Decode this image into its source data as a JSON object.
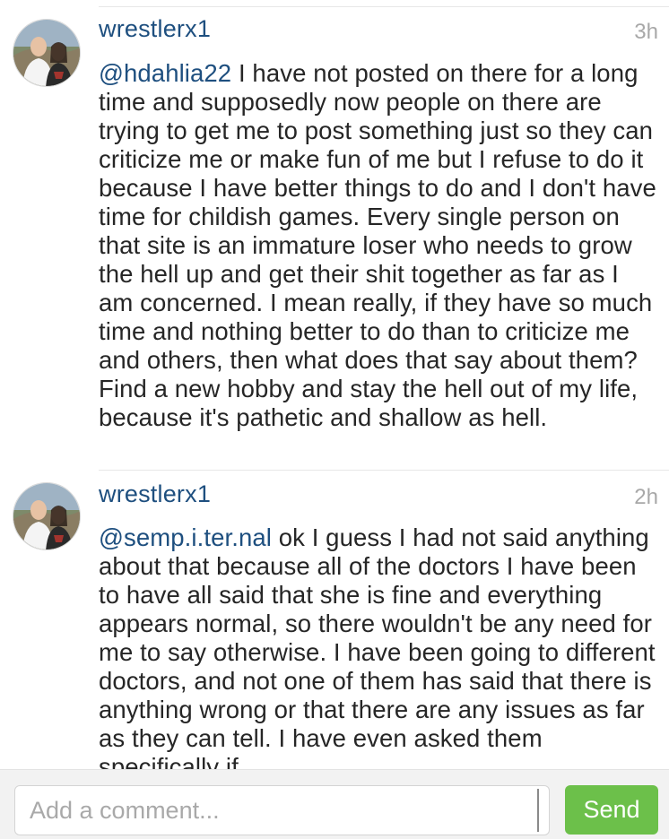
{
  "comments": [
    {
      "username": "wrestlerx1",
      "time": "3h",
      "mention": "@hdahlia22",
      "text": " I have not posted on there for a long time and supposedly now people on there are trying to get me to post something just so they can criticize me or make fun of me but I refuse to do it because I have better things to do and I don't have time for childish games. Every single person on that site is an immature loser who needs to grow the hell up and get their shit together as far as I am concerned. I mean really, if they have so much time and nothing better to do than to criticize me and others, then what does that say about them? Find a new hobby and stay the hell out of my life, because it's pathetic and shallow as hell.",
      "avatar_icon": "user-avatar-photo"
    },
    {
      "username": "wrestlerx1",
      "time": "2h",
      "mention": "@semp.i.ter.nal",
      "text": " ok I guess I had not said anything about that because all of the doctors I have been to have all said that she is fine and everything appears normal, so there wouldn't be any need for me to say otherwise. I have been going to different doctors, and not one of them has said that there is anything wrong or that there are any issues as far as they can tell. I have even asked them specifically if",
      "avatar_icon": "user-avatar-photo"
    }
  ],
  "composer": {
    "placeholder": "Add a comment...",
    "value": "",
    "send_label": "Send"
  },
  "colors": {
    "username": "#1e4f7f",
    "mention": "#1e4f7f",
    "send_button": "#6cc04a",
    "timestamp": "#a8a8a8"
  }
}
